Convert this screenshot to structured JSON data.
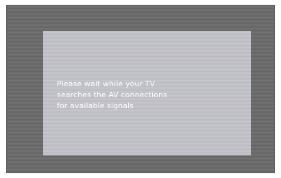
{
  "message": {
    "lines": [
      "Please wait while your TV",
      "searches the AV connections",
      "for available signals"
    ]
  }
}
